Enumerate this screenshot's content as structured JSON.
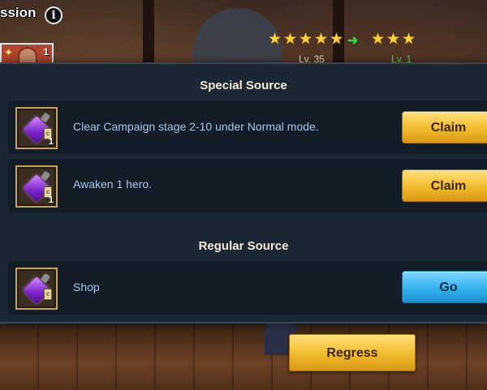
{
  "header": {
    "title": "ssion",
    "info_icon": "info-icon",
    "hero_card": {
      "count": "1",
      "class_icon": "sparkle-icon"
    },
    "stars_before": 5,
    "stars_after": 3,
    "level_before": "Lv. 35",
    "level_after": "Lv. 1",
    "colors": {
      "star": "#ffd23a",
      "arrow": "#3fd24b"
    }
  },
  "modal": {
    "special_title": "Special Source",
    "regular_title": "Regular Source",
    "special_sources": [
      {
        "text": "Clear Campaign stage 2-10 under Normal mode.",
        "qty": "1",
        "button": "Claim",
        "icon": "potion-icon"
      },
      {
        "text": "Awaken 1 hero.",
        "qty": "1",
        "button": "Claim",
        "icon": "potion-icon"
      }
    ],
    "regular_sources": [
      {
        "text": "Shop",
        "button": "Go",
        "icon": "potion-icon"
      }
    ],
    "colors": {
      "claim": "#f3be32",
      "go": "#33b1ec",
      "panel": "#1b2733",
      "row": "#121d27"
    }
  },
  "footer": {
    "regress_label": "Regress"
  }
}
